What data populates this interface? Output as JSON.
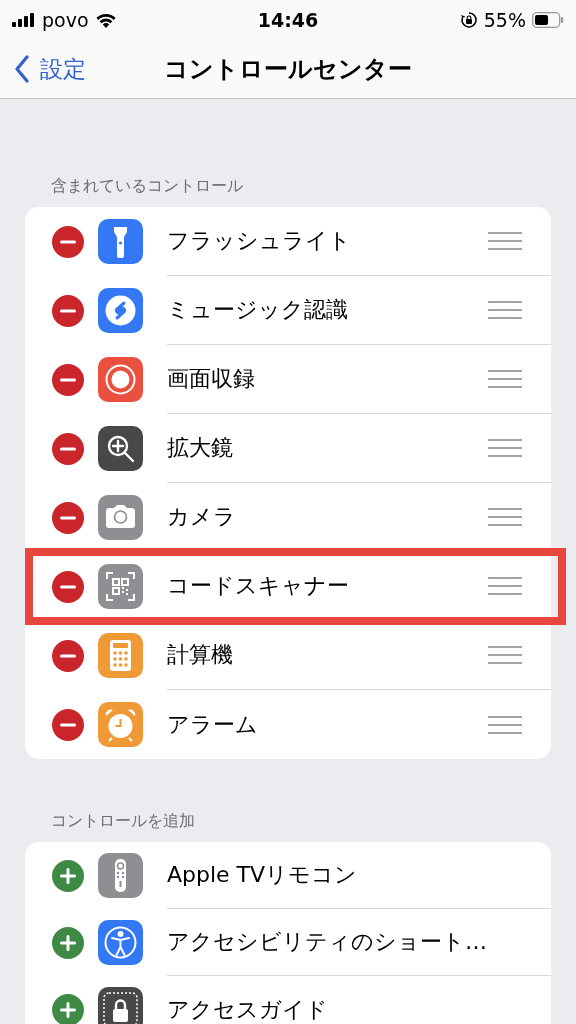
{
  "status_bar": {
    "carrier": "povo",
    "time": "14:46",
    "battery": "55%"
  },
  "nav": {
    "back": "設定",
    "title": "コントロールセンター"
  },
  "sections": [
    {
      "header": "含まれているコントロール",
      "kind": "remove",
      "items": [
        {
          "label": "フラッシュライト",
          "color": "#3478f6",
          "highlighted": false
        },
        {
          "label": "ミュージック認識",
          "color": "#3478f6",
          "highlighted": false
        },
        {
          "label": "画面収録",
          "color": "#e9503f",
          "highlighted": false
        },
        {
          "label": "拡大鏡",
          "color": "#48484a",
          "highlighted": false
        },
        {
          "label": "カメラ",
          "color": "#8e8e93",
          "highlighted": false
        },
        {
          "label": "コードスキャナー",
          "color": "#8e8e93",
          "highlighted": true
        },
        {
          "label": "計算機",
          "color": "#f09a37",
          "highlighted": false
        },
        {
          "label": "アラーム",
          "color": "#f09a37",
          "highlighted": false
        }
      ]
    },
    {
      "header": "コントロールを追加",
      "kind": "add",
      "items": [
        {
          "label": "Apple TVリモコン",
          "color": "#8e8e93",
          "highlighted": false
        },
        {
          "label": "アクセシビリティのショート…",
          "color": "#3478f6",
          "highlighted": false
        },
        {
          "label": "アクセスガイド",
          "color": "#48484a",
          "highlighted": false
        }
      ]
    }
  ]
}
